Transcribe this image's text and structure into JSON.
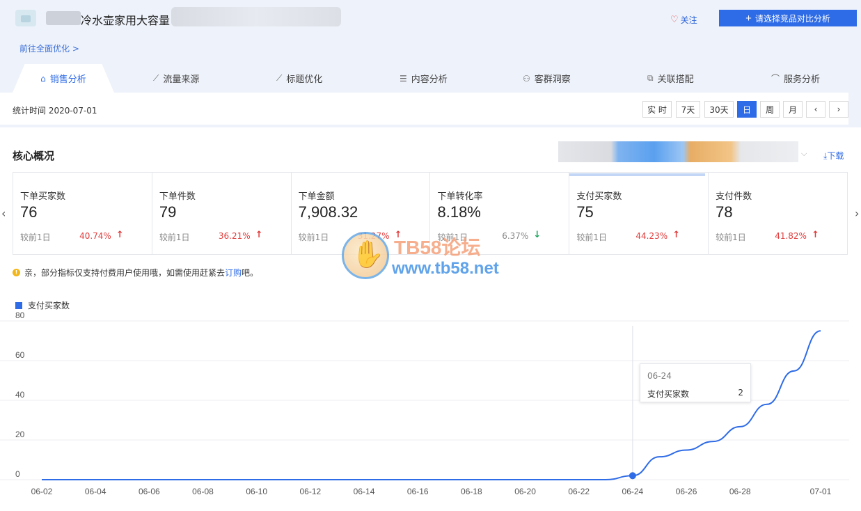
{
  "header": {
    "product_title": "冷水壶家用大容量",
    "breadcrumb": "前往全面优化 >",
    "follow_label": "关注",
    "compare_label": "请选择竞品对比分析"
  },
  "tabs": [
    {
      "label": "销售分析",
      "icon": "shopping-bag-icon",
      "active": true
    },
    {
      "label": "流量来源",
      "icon": "line-chart-icon"
    },
    {
      "label": "标题优化",
      "icon": "line-chart-icon"
    },
    {
      "label": "内容分析",
      "icon": "document-icon"
    },
    {
      "label": "客群洞察",
      "icon": "users-icon"
    },
    {
      "label": "关联搭配",
      "icon": "link-icon"
    },
    {
      "label": "服务分析",
      "icon": "headset-icon"
    }
  ],
  "stat_time": "统计时间 2020-07-01",
  "ranges": [
    "实 时",
    "7天",
    "30天",
    "日",
    "周",
    "月",
    "‹",
    "›"
  ],
  "active_range": "日",
  "overview": {
    "title": "核心概况",
    "download_label": "下载",
    "metrics": [
      {
        "label": "下单买家数",
        "value": "76",
        "compare_label": "较前1日",
        "change": "40.74%",
        "direction": "up"
      },
      {
        "label": "下单件数",
        "value": "79",
        "compare_label": "较前1日",
        "change": "36.21%",
        "direction": "up"
      },
      {
        "label": "下单金额",
        "value": "7,908.32",
        "compare_label": "较前1日",
        "change": "31.27%",
        "direction": "up"
      },
      {
        "label": "下单转化率",
        "value": "8.18%",
        "compare_label": "较前1日",
        "change": "6.37%",
        "direction": "down"
      },
      {
        "label": "支付买家数",
        "value": "75",
        "compare_label": "较前1日",
        "change": "44.23%",
        "direction": "up"
      },
      {
        "label": "支付件数",
        "value": "78",
        "compare_label": "较前1日",
        "change": "41.82%",
        "direction": "up"
      }
    ]
  },
  "notice": {
    "text": "亲，部分指标仅支持付费用户使用哦，如需使用赶紧去",
    "link": "订购",
    "suffix": "吧。"
  },
  "watermark": {
    "line1": "TB58论坛",
    "line2": "www.tb58.net"
  },
  "chart_data": {
    "type": "line",
    "series": [
      {
        "name": "支付买家数",
        "values": [
          0,
          0,
          0,
          0,
          0,
          0,
          0,
          0,
          0,
          0,
          0,
          0,
          0,
          0,
          0,
          0,
          0,
          0,
          0,
          0,
          0,
          0,
          2,
          4,
          6,
          8,
          11,
          14,
          17,
          22,
          30,
          41,
          57,
          75
        ]
      }
    ],
    "x": [
      "06-02",
      "06-03",
      "06-04",
      "06-05",
      "06-06",
      "06-07",
      "06-08",
      "06-09",
      "06-10",
      "06-11",
      "06-12",
      "06-13",
      "06-14",
      "06-15",
      "06-16",
      "06-17",
      "06-18",
      "06-19",
      "06-20",
      "06-21",
      "06-22",
      "06-23",
      "06-24",
      "06-25",
      "06-26",
      "06-27",
      "06-28",
      "06-29",
      "06-30",
      "07-01"
    ],
    "x_ticks": [
      "06-02",
      "06-04",
      "06-06",
      "06-08",
      "06-10",
      "06-12",
      "06-14",
      "06-16",
      "06-18",
      "06-20",
      "06-22",
      "06-24",
      "06-26",
      "06-28",
      "07-01"
    ],
    "y_ticks": [
      0,
      20,
      40,
      60,
      80
    ],
    "ylim": [
      0,
      80
    ],
    "tooltip": {
      "date": "06-24",
      "name": "支付买家数",
      "value": 2
    },
    "color": "#2e6be6"
  }
}
